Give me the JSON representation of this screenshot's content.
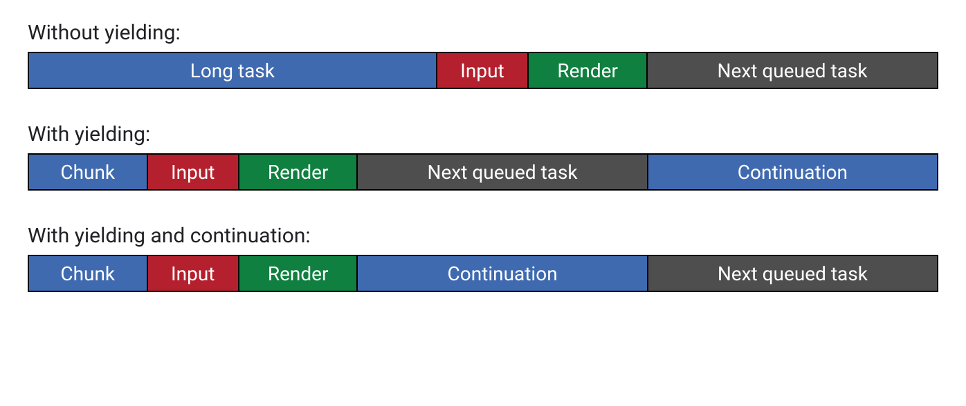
{
  "sections": [
    {
      "title": "Without yielding:",
      "segments": [
        {
          "label": "Long task",
          "color": "blue",
          "weight": 45
        },
        {
          "label": "Input",
          "color": "red",
          "weight": 10
        },
        {
          "label": "Render",
          "color": "green",
          "weight": 13
        },
        {
          "label": "Next queued task",
          "color": "gray",
          "weight": 32
        }
      ]
    },
    {
      "title": "With yielding:",
      "segments": [
        {
          "label": "Chunk",
          "color": "blue",
          "weight": 13
        },
        {
          "label": "Input",
          "color": "red",
          "weight": 10
        },
        {
          "label": "Render",
          "color": "green",
          "weight": 13
        },
        {
          "label": "Next queued task",
          "color": "gray",
          "weight": 32
        },
        {
          "label": "Continuation",
          "color": "blue",
          "weight": 32
        }
      ]
    },
    {
      "title": "With yielding and continuation:",
      "segments": [
        {
          "label": "Chunk",
          "color": "blue",
          "weight": 13
        },
        {
          "label": "Input",
          "color": "red",
          "weight": 10
        },
        {
          "label": "Render",
          "color": "green",
          "weight": 13
        },
        {
          "label": "Continuation",
          "color": "blue",
          "weight": 32
        },
        {
          "label": "Next queued task",
          "color": "gray",
          "weight": 32
        }
      ]
    }
  ]
}
